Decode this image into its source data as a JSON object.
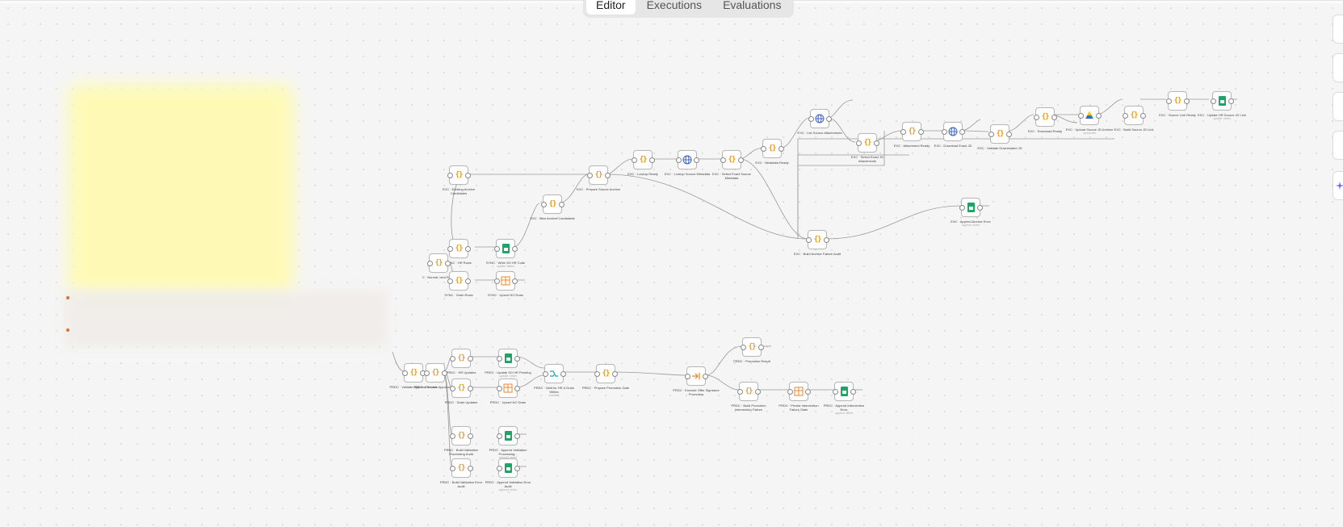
{
  "tabs": [
    "Editor",
    "Executions",
    "Evaluations"
  ],
  "active_tab": "Editor",
  "nodes": {
    "n01": {
      "label": "EXC · Existing Archive Candidates",
      "sub": ""
    },
    "n02": {
      "label": "EXC · Prepare Source Archive",
      "sub": ""
    },
    "n03": {
      "label": "EXC · Lookup Ready",
      "sub": ""
    },
    "n04": {
      "label": "EXC · Lookup Source Metadata",
      "sub": ""
    },
    "n05": {
      "label": "EXC · Select Exact Source Metadata",
      "sub": ""
    },
    "n06": {
      "label": "EXC · Metadata Ready",
      "sub": ""
    },
    "n07": {
      "label": "EXC · List Source Attachments",
      "sub": ""
    },
    "n08": {
      "label": "EXC · Select Exact JD Attachments",
      "sub": ""
    },
    "n09": {
      "label": "EXC · Attachment Ready",
      "sub": ""
    },
    "n10": {
      "label": "EXC · Download Exact JD",
      "sub": ""
    },
    "n11": {
      "label": "EXC · Validate Downloaded JD",
      "sub": ""
    },
    "n12": {
      "label": "EXC · Download Ready",
      "sub": ""
    },
    "n13": {
      "label": "EXC · Upload Source JD Archive",
      "sub": "upload file"
    },
    "n14": {
      "label": "EXC · Build Source JD Link",
      "sub": ""
    },
    "n15": {
      "label": "EXC · Source Link Ready",
      "sub": ""
    },
    "n16": {
      "label": "EXC · Update HR Source JD Link",
      "sub": "update: sheet"
    },
    "n17": {
      "label": "EXC · New Archive Candidates",
      "sub": ""
    },
    "n18": {
      "label": "EXC · Build Archive Failure Audit",
      "sub": ""
    },
    "n19": {
      "label": "EXC · Append Archive Error",
      "sub": "append: sheet"
    },
    "n20": {
      "label": "SYNC · HR Rows",
      "sub": ""
    },
    "n21": {
      "label": "SYNC · Write SO HR Cutie",
      "sub": "update: sheet"
    },
    "n22": {
      "label": "C · Normal- ized Roles",
      "sub": ""
    },
    "n23": {
      "label": "SYNC · Drain Rows",
      "sub": ""
    },
    "n24": {
      "label": "SYNC · Upsert NO Drain",
      "sub": ""
    },
    "n25": {
      "label": "PRDC · Validate Approval & Lock",
      "sub": ""
    },
    "n26": {
      "label": "PRDC · Resolve Approved JD",
      "sub": ""
    },
    "n27": {
      "label": "PRDC · HR Updates",
      "sub": ""
    },
    "n28": {
      "label": "PRDC · Update SO HR Pending",
      "sub": "update: sheet"
    },
    "n29": {
      "label": "PRDC · Drain Updates",
      "sub": ""
    },
    "n30": {
      "label": "PRDC · Upsert NO Drain",
      "sub": ""
    },
    "n31": {
      "label": "PRDC · Wait for HR & Drain Writes",
      "sub": "combine"
    },
    "n32": {
      "label": "PRDC · Prepare Promotion Gate",
      "sub": ""
    },
    "n33": {
      "label": "PRDC · Execute Offer Signature Promotion",
      "sub": ""
    },
    "n34": {
      "label": "PRDC · Promotion Result",
      "sub": ""
    },
    "n35": {
      "label": "PRDC · Build Promotion Intervention Failure",
      "sub": ""
    },
    "n36": {
      "label": "PRDC · Persist Intervention Failure State",
      "sub": ""
    },
    "n37": {
      "label": "PRDC · Append Intervention Error",
      "sub": "append: sheet"
    },
    "n38": {
      "label": "PRDC · Build Validation Processing Audit",
      "sub": ""
    },
    "n39": {
      "label": "PRDC · Append Validation Processing...",
      "sub": "append: sheet"
    },
    "n40": {
      "label": "PRDC · Build Validation Error Audit",
      "sub": ""
    },
    "n41": {
      "label": "PRDC · Append Validation Error Audit",
      "sub": "append: sheet"
    }
  },
  "colors": {
    "code": "#e89b25",
    "sheets": "#1fa463",
    "http": "#3b63c7",
    "table": "#f0862b",
    "wait": "#15a5c9",
    "offer": "#f08a28",
    "accent": "#7b5bff"
  },
  "icons": {
    "code": "braces-icon",
    "sheets": "google-sheets-icon",
    "http": "globe-icon",
    "table": "table-icon",
    "wait": "merge-icon",
    "offer": "arrow-in-icon",
    "drive": "google-drive-icon"
  }
}
